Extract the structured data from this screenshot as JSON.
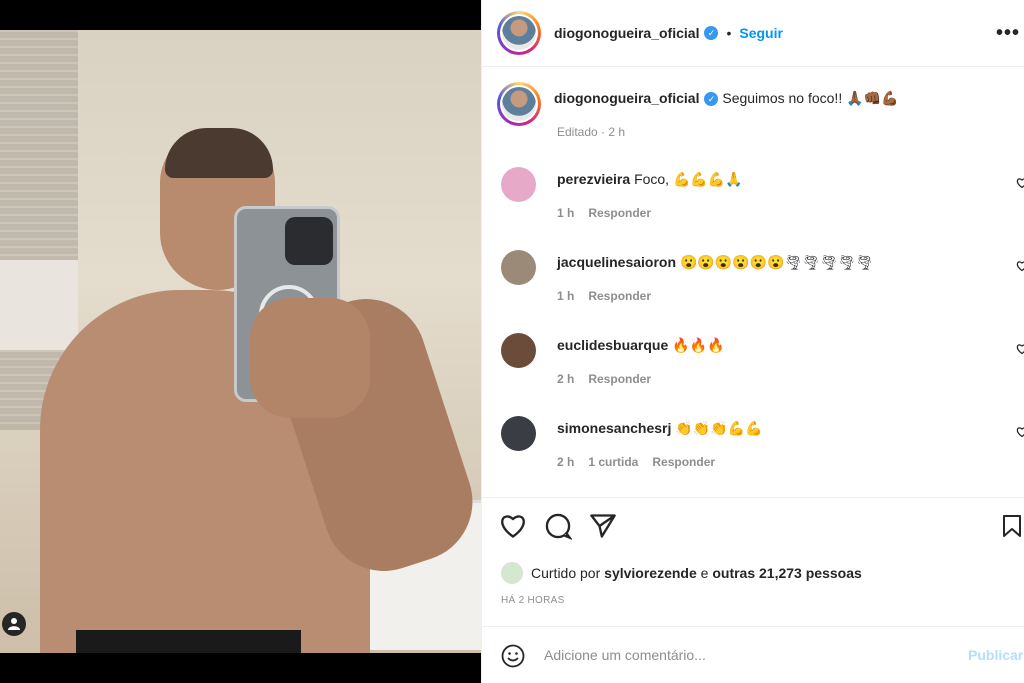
{
  "post": {
    "username": "diogonogueira_oficial",
    "follow_label": "Seguir",
    "more_label": "•••",
    "dot": "•",
    "verified_mark": "✓",
    "caption_text": "Seguimos no foco!!",
    "caption_emoji": "🙏🏾👊🏾💪🏾",
    "edited": "Editado · 2 h"
  },
  "comments": [
    {
      "user": "perezvieira",
      "text": "Foco, ",
      "emoji": "💪💪💪🙏",
      "time": "1 h",
      "likes": "",
      "reply": "Responder",
      "avatar_color": "#e7a9c8"
    },
    {
      "user": "jacquelinesaioron",
      "text": "",
      "emoji": "😮😮😮😮😮😮🌪🌪🌪🌪🌪",
      "time": "1 h",
      "likes": "",
      "reply": "Responder",
      "avatar_color": "#9b8a78"
    },
    {
      "user": "euclidesbuarque",
      "text": "",
      "emoji": "🔥🔥🔥",
      "time": "2 h",
      "likes": "",
      "reply": "Responder",
      "avatar_color": "#6b4c3b"
    },
    {
      "user": "simonesanchesrj",
      "text": "",
      "emoji": "👏👏👏💪💪",
      "time": "2 h",
      "likes": "1 curtida",
      "reply": "Responder",
      "avatar_color": "#3b3d44"
    }
  ],
  "likes": {
    "prefix": "Curtido por",
    "user": "sylviorezende",
    "middle": "e",
    "others": "outras 21,273 pessoas"
  },
  "timestamp": "HÁ 2 HORAS",
  "comment_box": {
    "placeholder": "Adicione um comentário...",
    "publish": "Publicar"
  },
  "photo": {
    "user_tag_icon": "person-icon"
  }
}
